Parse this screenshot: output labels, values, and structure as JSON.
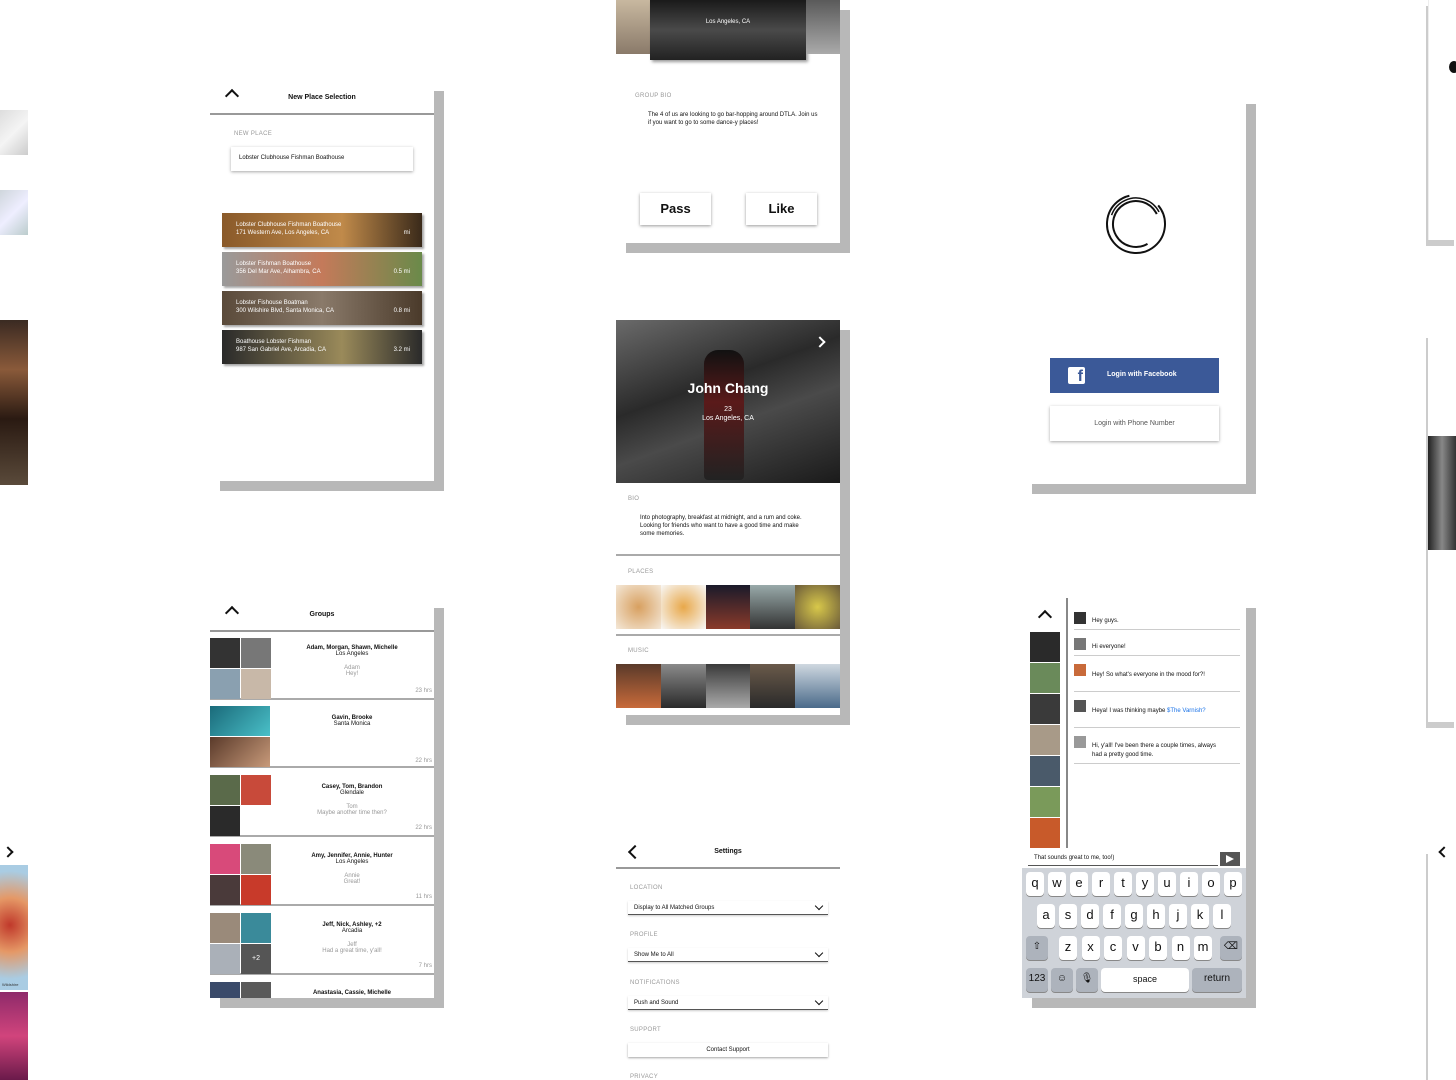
{
  "colors": {
    "facebook": "#3b5998",
    "link": "#1a73e8",
    "accent_dark": "#111111"
  },
  "place_selection": {
    "title": "New Place Selection",
    "new_place_label": "NEW PLACE",
    "input_value": "Lobster Clubhouse Fishman Boathouse",
    "results": [
      {
        "name": "Lobster Clubhouse Fishman Boathouse",
        "address": "171 Western Ave, Los Angeles, CA",
        "distance": "mi"
      },
      {
        "name": "Lobster Fishman Boathouse",
        "address": "356 Del Mar Ave, Alhambra, CA",
        "distance": "0.5 mi"
      },
      {
        "name": "Lobster Fishouse Boatman",
        "address": "300 Wilshire Blvd, Santa Monica, CA",
        "distance": "0.8 mi"
      },
      {
        "name": "Boathouse Lobster Fishman",
        "address": "987 San Gabriel Ave, Arcadia, CA",
        "distance": "3.2 mi"
      }
    ]
  },
  "group_profile": {
    "location": "Los Angeles, CA",
    "bio_label": "GROUP BIO",
    "bio": "The 4 of us are looking to go bar-hopping around DTLA. Join us if you want to go to some dance-y places!",
    "pass_label": "Pass",
    "like_label": "Like"
  },
  "login": {
    "facebook_label": "Login with Facebook",
    "phone_label": "Login with Phone Number"
  },
  "user_profile": {
    "name": "John Chang",
    "age": "23",
    "location": "Los Angeles, CA",
    "bio_label": "BIO",
    "bio": "Into photography, breakfast at midnight, and a rum and coke. Looking for friends who want to have a good time and make some memories.",
    "places_label": "PLACES",
    "music_label": "MUSIC"
  },
  "groups": {
    "title": "Groups",
    "rows": [
      {
        "names": "Adam, Morgan, Shawn, Michelle",
        "place": "Los Angeles",
        "sender": "Adam",
        "message": "Hey!",
        "time": "23 hrs"
      },
      {
        "names": "Gavin, Brooke",
        "place": "Santa Monica",
        "sender": "",
        "message": "",
        "time": "22 hrs"
      },
      {
        "names": "Casey, Tom, Brandon",
        "place": "Glendale",
        "sender": "Tom",
        "message": "Maybe another time then?",
        "time": "22 hrs"
      },
      {
        "names": "Amy, Jennifer, Annie, Hunter",
        "place": "Los Angeles",
        "sender": "Annie",
        "message": "Great!",
        "time": "11 hrs"
      },
      {
        "names": "Jeff, Nick, Ashley, +2",
        "place": "Arcadia",
        "sender": "Jeff",
        "message": "Had a great time, y'all!",
        "time": "7 hrs",
        "extra": "+2"
      },
      {
        "names": "Anastasia, Cassie, Michelle",
        "place": "",
        "sender": "",
        "message": "",
        "time": ""
      }
    ]
  },
  "settings": {
    "title": "Settings",
    "location_label": "LOCATION",
    "location_value": "Display to All Matched Groups",
    "profile_label": "PROFILE",
    "profile_value": "Show Me to All",
    "notifications_label": "NOTIFICATIONS",
    "notifications_value": "Push and Sound",
    "support_label": "SUPPORT",
    "support_button": "Contact Support",
    "privacy_label": "PRIVACY"
  },
  "chat": {
    "messages": [
      {
        "text": "Hey guys.",
        "link": ""
      },
      {
        "text": "Hi everyone!",
        "link": ""
      },
      {
        "text": "Hey! So what's everyone in the mood for?!",
        "link": ""
      },
      {
        "text": "Heya! I was thinking maybe ",
        "link": "$The Varnish?"
      },
      {
        "text": "Hi, y'all! I've been there a couple times, always had a pretty good time.",
        "link": ""
      }
    ],
    "input_value": "That sounds great to me, too!)",
    "keyboard": {
      "row1": [
        "q",
        "w",
        "e",
        "r",
        "t",
        "y",
        "u",
        "i",
        "o",
        "p"
      ],
      "row2": [
        "a",
        "s",
        "d",
        "f",
        "g",
        "h",
        "j",
        "k",
        "l"
      ],
      "row3": [
        "z",
        "x",
        "c",
        "v",
        "b",
        "n",
        "m"
      ],
      "numbers": "123",
      "space": "space",
      "return": "return"
    }
  },
  "map_fragment": {
    "label": "Wildshire"
  }
}
